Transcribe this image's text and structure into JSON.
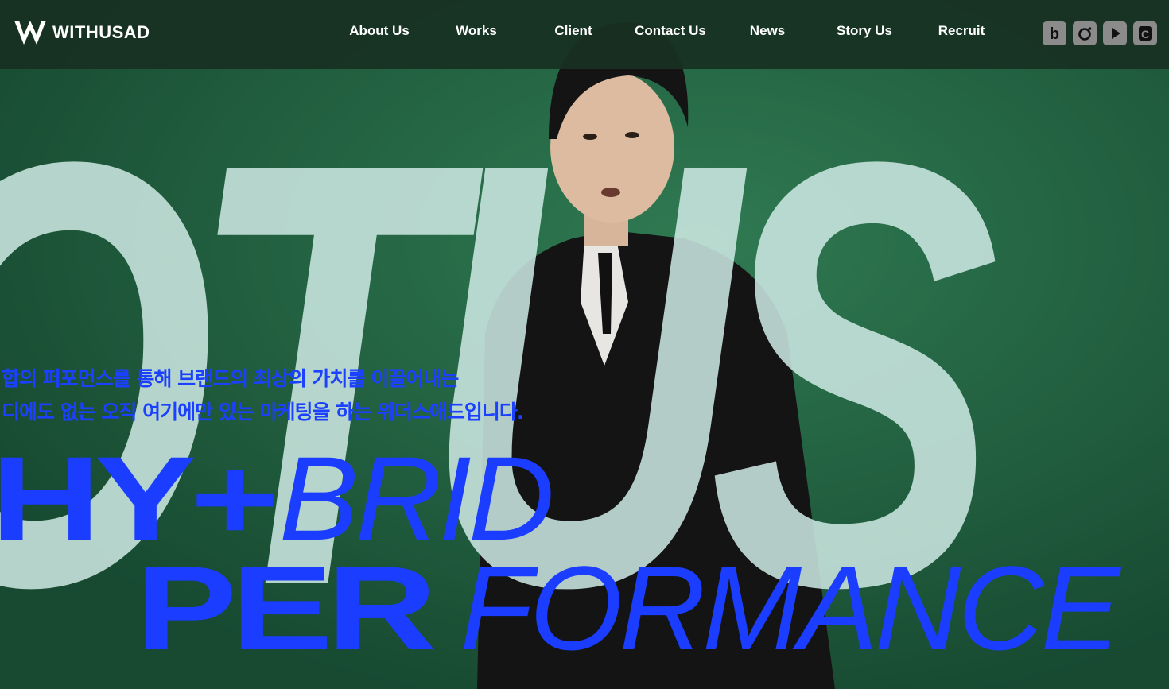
{
  "header": {
    "logo_text": "WITHUSAD",
    "nav": [
      {
        "label": "About Us"
      },
      {
        "label": "Works"
      },
      {
        "label": "Client"
      },
      {
        "label": "Contact Us"
      },
      {
        "label": "News"
      },
      {
        "label": "Story Us"
      },
      {
        "label": "Recruit"
      }
    ],
    "socials": [
      {
        "icon": "blog-b-icon",
        "glyph": "b"
      },
      {
        "icon": "instagram-icon",
        "glyph": ""
      },
      {
        "icon": "youtube-icon",
        "glyph": ""
      },
      {
        "icon": "brunch-icon",
        "glyph": "C"
      }
    ]
  },
  "hero": {
    "background_word": "OTUS",
    "tagline_lines": [
      "합의 퍼포먼스를 통해 브랜드의 최상의 가치를 이끌어내는",
      "디에도 없는 오직 여기에만 있는 마케팅을 하는 위더스애드입니다."
    ],
    "slogan_line1_bold": "HY+",
    "slogan_line1_thin": "BRID",
    "slogan_line2_bold": "PER",
    "slogan_line2_thin": "FORMANCE"
  },
  "colors": {
    "background_green": "#1f5c3d",
    "accent_blue": "#1a3dff",
    "letter_overlay": "#cde8e2",
    "header_bg": "#183022",
    "social_bg": "#8b8b8b"
  }
}
